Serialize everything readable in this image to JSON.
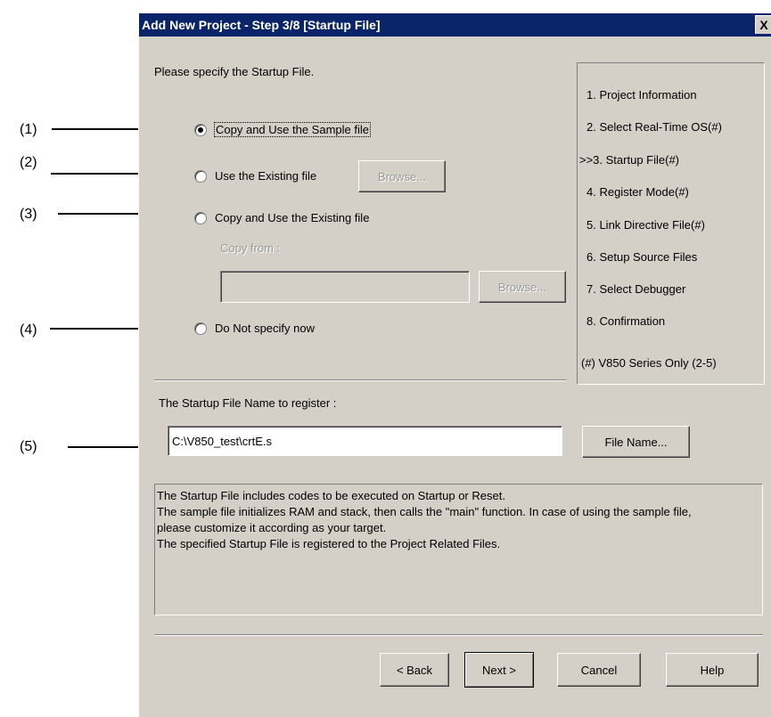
{
  "callouts": [
    "(1)",
    "(2)",
    "(3)",
    "(4)",
    "(5)"
  ],
  "dialog": {
    "title": "Add New Project - Step 3/8 [Startup File]",
    "close_label": "X",
    "instruction": "Please specify the Startup File.",
    "options": {
      "copy_sample": "Copy and Use the Sample file",
      "use_existing": "Use the Existing file",
      "copy_existing": "Copy and Use the Existing file",
      "not_specify": "Do Not specify now"
    },
    "selected_option": "copy_sample",
    "browse_label": "Browse...",
    "copy_from_label": "Copy from :",
    "copy_from_value": "",
    "startup_name_label": "The Startup File Name to register :",
    "startup_name_value": "C:\\V850_test\\crtE.s",
    "file_name_button": "File Name...",
    "description": [
      "The Startup File includes codes to be executed on Startup or Reset.",
      "The sample file initializes RAM and stack, then calls the \"main\" function. In case of using the sample file,",
      "please customize it according as your target.",
      "The specified Startup File is registered to the Project Related Files."
    ],
    "steps": [
      "1. Project Information",
      "2. Select Real-Time OS(#)",
      ">>3. Startup File(#)",
      "4. Register Mode(#)",
      "5. Link Directive File(#)",
      "6. Setup Source Files",
      "7. Select Debugger",
      "8. Confirmation"
    ],
    "steps_note": "(#) V850 Series Only (2-5)",
    "buttons": {
      "back": "< Back",
      "next": "Next >",
      "cancel": "Cancel",
      "help": "Help"
    }
  }
}
